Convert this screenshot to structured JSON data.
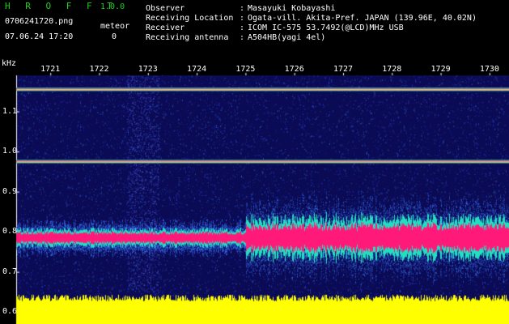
{
  "app": {
    "name": "H R O F F T",
    "version": "1.0.0",
    "filename": "0706241720.png",
    "mode": "meteor",
    "datetime": "07.06.24 17:20",
    "count": "0"
  },
  "header": {
    "rows": [
      {
        "key": "Observer",
        "value": "Masayuki Kobayashi"
      },
      {
        "key": "Receiving Location",
        "value": "Ogata-vill. Akita-Pref. JAPAN (139.96E, 40.02N)"
      },
      {
        "key": "Receiver",
        "value": "ICOM IC-575 53.7492(@LCD)MHz USB"
      },
      {
        "key": "Receiving antenna",
        "value": "A504HB(yagi 4el)"
      }
    ]
  },
  "colors": {
    "background": "#000000",
    "spectrogram_bg": "#0a0a55",
    "noise": "#2a3cff",
    "hot": "#ff1a7a",
    "mid": "#20e0c0",
    "floor": "#ffff00",
    "text_green": "#1fd01f"
  },
  "chart_data": {
    "type": "heatmap",
    "ylabel": "kHz",
    "x_ticks": [
      "1721",
      "1722",
      "1723",
      "1724",
      "1725",
      "1726",
      "1727",
      "1728",
      "1729",
      "1730"
    ],
    "y_ticks": [
      "1.1",
      "1.0",
      "0.9",
      "0.8",
      "0.7",
      "0.6"
    ],
    "ylim": [
      0.57,
      1.19
    ],
    "xlim": [
      1720.3,
      1730.4
    ],
    "bands": [
      {
        "freq": 1.155,
        "kind": "carrier"
      },
      {
        "freq": 0.975,
        "kind": "carrier"
      },
      {
        "freq": 0.785,
        "kind": "signal"
      }
    ],
    "floor_top": 0.635
  }
}
